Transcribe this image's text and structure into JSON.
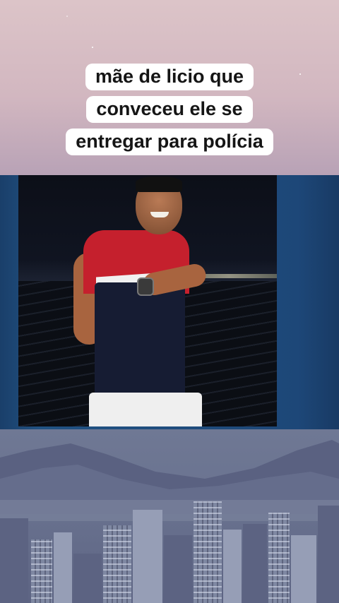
{
  "caption": {
    "lines": [
      "mãe de licio que",
      "conveceu ele se",
      "entregar para polícia"
    ]
  },
  "colors": {
    "caption_bg": "#ffffff",
    "caption_text": "#151515",
    "news_frame_blue": "#215283",
    "shirt_red": "#c5202d",
    "shirt_navy": "#161c33"
  },
  "icons": [
    "pixel-city-skyline"
  ]
}
